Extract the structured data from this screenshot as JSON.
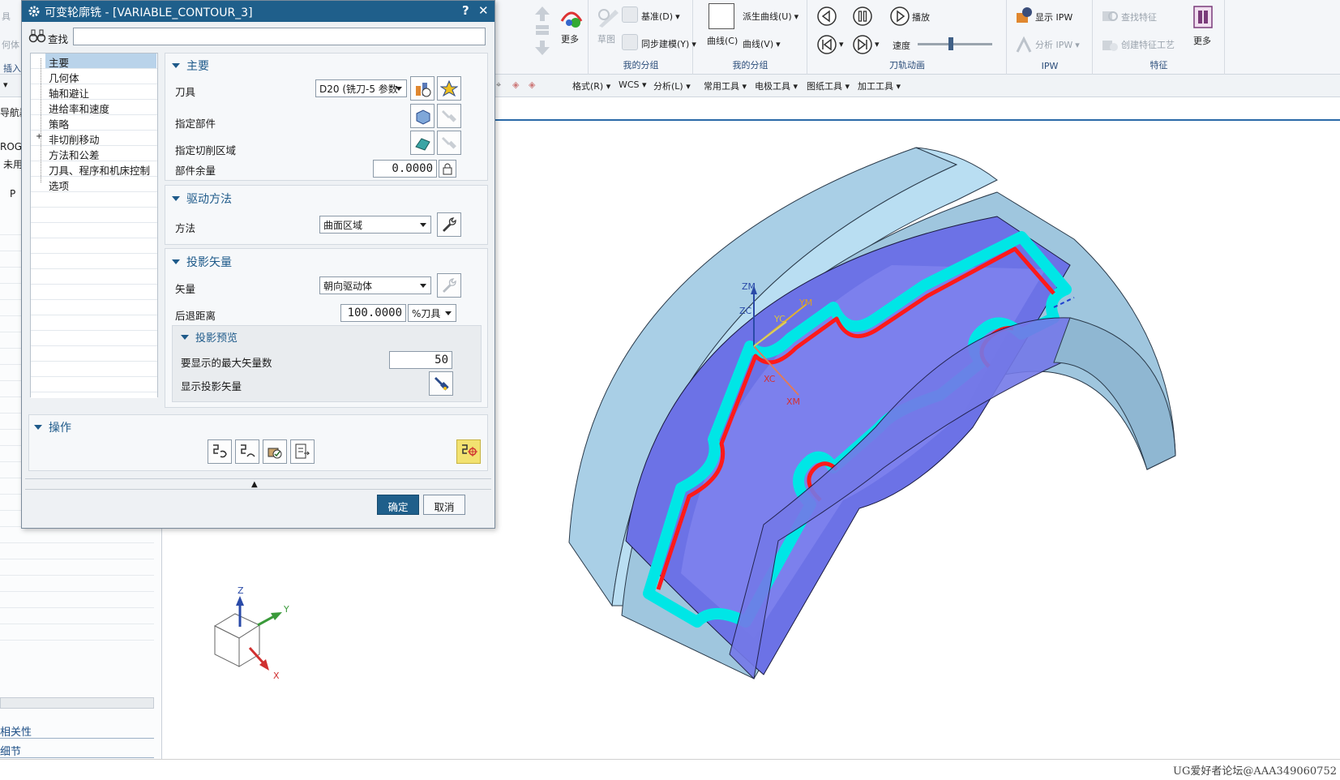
{
  "window_partial": {
    "left_ribbon_labels": [
      "具",
      "何体",
      "插入"
    ],
    "left_nav_partial": [
      "导航器",
      "ROG",
      "未用",
      "P"
    ],
    "left_bottom_labels": [
      "相关性",
      "细节"
    ]
  },
  "ribbon": {
    "groups": [
      {
        "label": "",
        "items": [
          "更多"
        ]
      },
      {
        "label": "我的分组",
        "items": [
          "草图",
          "基准(D)",
          "同步建模(Y)"
        ]
      },
      {
        "label": "我的分组",
        "items": [
          "曲线(C)",
          "派生曲线(U)",
          "曲线(V)"
        ]
      },
      {
        "label": "刀轨动画",
        "items": [
          "播放",
          "速度"
        ]
      },
      {
        "label": "IPW",
        "items": [
          "显示 IPW",
          "分析 IPW"
        ]
      },
      {
        "label": "特征",
        "items": [
          "查找特征",
          "创建特征工艺",
          "更多"
        ]
      }
    ]
  },
  "toolbar2": {
    "menus": [
      "格式(R)",
      "WCS",
      "分析(L)",
      "常用工具",
      "电极工具",
      "图纸工具",
      "加工工具"
    ]
  },
  "dialog": {
    "title": "可变轮廓铣 - [VARIABLE_CONTOUR_3]",
    "title_help": "?",
    "title_close": "✕",
    "search_label": "查找",
    "search_value": "",
    "tree": [
      "主要",
      "几何体",
      "轴和避让",
      "进给率和速度",
      "策略",
      "非切削移动",
      "方法和公差",
      "刀具、程序和机床控制",
      "选项"
    ],
    "tree_selected": "主要",
    "main": {
      "header": "主要",
      "tool_label": "刀具",
      "tool_value": "D20 (铣刀-5 参数",
      "part_label": "指定部件",
      "cut_area_label": "指定切削区域",
      "stock_label": "部件余量",
      "stock_value": "0.0000"
    },
    "drive": {
      "header": "驱动方法",
      "method_label": "方法",
      "method_value": "曲面区域"
    },
    "projection": {
      "header": "投影矢量",
      "vector_label": "矢量",
      "vector_value": "朝向驱动体",
      "retract_label": "后退距离",
      "retract_value": "100.0000",
      "retract_unit": "%刀具",
      "preview_header": "投影预览",
      "max_vectors_label": "要显示的最大矢量数",
      "max_vectors_value": "50",
      "show_vectors_label": "显示投影矢量"
    },
    "operation": {
      "header": "操作"
    },
    "ok_label": "确定",
    "cancel_label": "取消"
  },
  "viewport": {
    "axis_labels": [
      "ZM",
      "ZC",
      "YC",
      "YM",
      "XC",
      "XM"
    ],
    "triad_labels": [
      "Z",
      "Y",
      "X"
    ],
    "colors": {
      "part_body": "#a9cfe6",
      "floor": "#6c72e6",
      "wall_top": "#00e6e6",
      "wall_side": "#ff1a1a"
    }
  },
  "watermark": "UG爱好者论坛@AAA349060752"
}
